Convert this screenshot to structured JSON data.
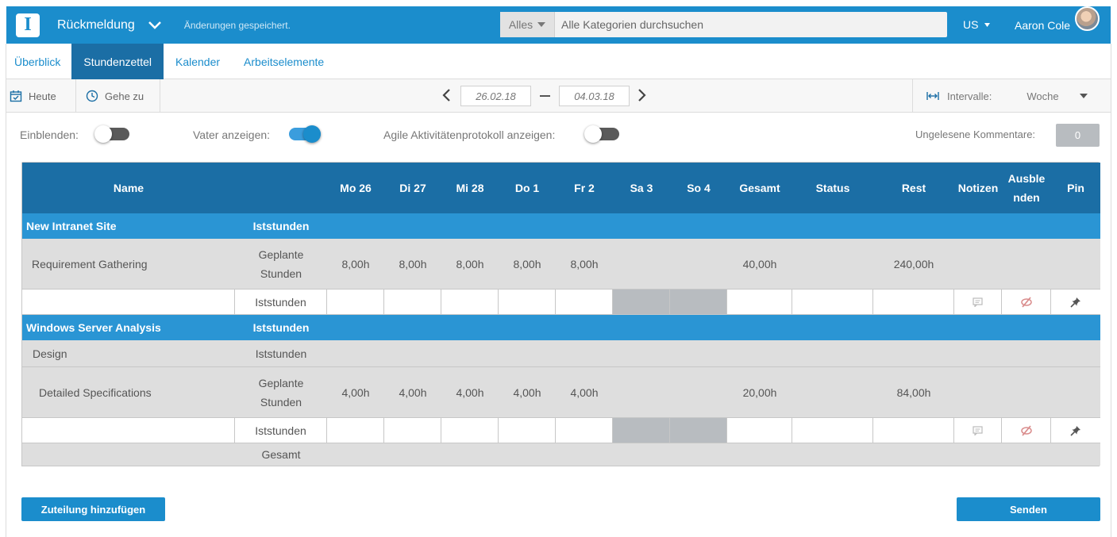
{
  "header": {
    "logo_letter": "I",
    "app_title": "Rückmeldung",
    "save_status": "Änderungen gespeichert.",
    "search_scope": "Alles",
    "search_placeholder": "Alle Kategorien durchsuchen",
    "language": "US",
    "user_name": "Aaron Cole"
  },
  "tabs": [
    {
      "label": "Überblick",
      "active": false
    },
    {
      "label": "Stundenzettel",
      "active": true
    },
    {
      "label": "Kalender",
      "active": false
    },
    {
      "label": "Arbeitselemente",
      "active": false
    }
  ],
  "toolbar": {
    "today_label": "Heute",
    "goto_label": "Gehe zu",
    "date_from": "26.02.18",
    "date_to": "04.03.18",
    "interval_label": "Intervalle:",
    "interval_value": "Woche"
  },
  "options": {
    "show_label": "Einblenden:",
    "show_on": false,
    "parent_label": "Vater anzeigen:",
    "parent_on": true,
    "agile_label": "Agile Aktivitätenprotokoll anzeigen:",
    "agile_on": false,
    "unread_label": "Ungelesene Kommentare:",
    "unread_count": "0"
  },
  "grid": {
    "columns": {
      "name": "Name",
      "days": [
        "Mo 26",
        "Di 27",
        "Mi 28",
        "Do 1",
        "Fr 2",
        "Sa 3",
        "So 4"
      ],
      "total": "Gesamt",
      "status": "Status",
      "rest": "Rest",
      "notes": "Notizen",
      "hide_line1": "Ausble",
      "hide_line2": "nden",
      "pin": "Pin"
    },
    "type_actual": "Iststunden",
    "type_planned_line1": "Geplante",
    "type_planned_line2": "Stunden",
    "project1": {
      "name": "New Intranet Site",
      "task": "Requirement Gathering",
      "planned": [
        "8,00h",
        "8,00h",
        "8,00h",
        "8,00h",
        "8,00h",
        "",
        ""
      ],
      "total": "40,00h",
      "rest": "240,00h"
    },
    "project2": {
      "name": "Windows Server Analysis",
      "subgroup": "Design",
      "task": "Detailed Specifications",
      "planned": [
        "4,00h",
        "4,00h",
        "4,00h",
        "4,00h",
        "4,00h",
        "",
        ""
      ],
      "total": "20,00h",
      "rest": "84,00h"
    },
    "footer_total": "Gesamt"
  },
  "actions": {
    "add_allocation": "Zuteilung hinzufügen",
    "submit": "Senden"
  },
  "colors": {
    "brand": "#1b8dcc",
    "header_dark": "#1b6ea5",
    "project_row": "#2a95d4",
    "row_gray": "#dedede",
    "weekend_shade": "#b8bcc0"
  },
  "icons": [
    "calendar-check-icon",
    "clock-icon",
    "chevron-left-icon",
    "chevron-right-icon",
    "interval-icon",
    "caret-down-icon",
    "comment-icon",
    "hide-icon",
    "pin-icon"
  ]
}
